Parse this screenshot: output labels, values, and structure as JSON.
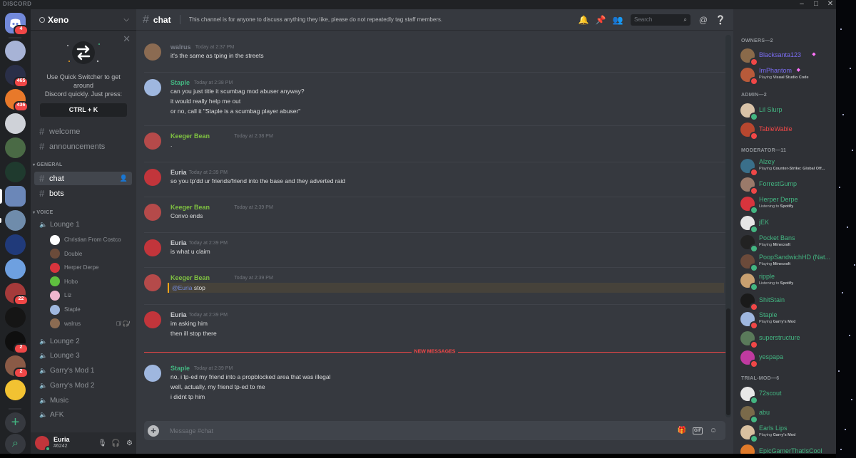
{
  "window": {
    "wordmark": "DISCORD",
    "min": "–",
    "max": "□",
    "close": "✕"
  },
  "guild_rail": {
    "home_badge": "4",
    "guilds": [
      {
        "color": "#a7b3d6",
        "badge": ""
      },
      {
        "color": "#2a2f48",
        "badge": "465"
      },
      {
        "color": "#e8792a",
        "badge": "436"
      },
      {
        "color": "#cfd2d8",
        "badge": ""
      },
      {
        "color": "#4a6a45",
        "badge": ""
      },
      {
        "color": "#1f3a2e",
        "badge": ""
      },
      {
        "color": "#6b87b8",
        "badge": ""
      },
      {
        "color": "#6f8cab",
        "badge": ""
      },
      {
        "color": "#203a7a",
        "badge": ""
      },
      {
        "color": "#6ea0e0",
        "badge": ""
      },
      {
        "color": "#a53a3a",
        "badge": "22"
      },
      {
        "color": "#151515",
        "badge": ""
      },
      {
        "color": "#0f0f0f",
        "badge": "2"
      },
      {
        "color": "#8a5a46",
        "badge": "2"
      },
      {
        "color": "#f2c232",
        "badge": ""
      }
    ],
    "add_icon": "+",
    "discover_icon": "⌕"
  },
  "server": {
    "name": "Xeno"
  },
  "quick_switcher": {
    "line1": "Use Quick Switcher to get around",
    "line2": "Discord quickly. Just press:",
    "key": "CTRL + K",
    "close": "✕"
  },
  "channels": {
    "top": [
      {
        "name": "welcome"
      },
      {
        "name": "announcements"
      }
    ],
    "general_label": "GENERAL",
    "general": [
      {
        "name": "chat"
      },
      {
        "name": "bots"
      }
    ],
    "voice_label": "VOICE",
    "voice": [
      {
        "name": "Lounge 1"
      },
      {
        "name": "Lounge 2"
      },
      {
        "name": "Lounge 3"
      },
      {
        "name": "Garry's Mod 1"
      },
      {
        "name": "Garry's Mod 2"
      },
      {
        "name": "Music"
      },
      {
        "name": "AFK"
      }
    ],
    "voice_users": [
      {
        "name": "Christian From Costco",
        "color": "#ffffff"
      },
      {
        "name": "Double",
        "color": "#6b4b3a"
      },
      {
        "name": "Herper Derpe",
        "color": "#d8343d"
      },
      {
        "name": "Hobo",
        "color": "#5fbf3f"
      },
      {
        "name": "Liz",
        "color": "#f0b6cf"
      },
      {
        "name": "Staple",
        "color": "#9fb7df"
      },
      {
        "name": "walrus",
        "color": "#8b6b52"
      }
    ]
  },
  "user_panel": {
    "name": "Euria",
    "tag": "#6242"
  },
  "chat": {
    "channel": "chat",
    "topic": "This channel is for anyone to discuss anything they like, please do not repeatedly tag staff members.",
    "search_placeholder": "Search",
    "composer_placeholder": "Message #chat",
    "new_messages": "NEW MESSAGES",
    "messages": [
      {
        "author": "walrus",
        "color": "#7a7f8a",
        "time": "Today at 2:37 PM",
        "avatar": "#8b6b52",
        "lines": [
          "it's the same as tping in the streets"
        ]
      },
      {
        "author": "Staple",
        "color": "#43b581",
        "time": "Today at 2:38 PM",
        "avatar": "#9fb7df",
        "lines": [
          "can you just title it scumbag mod abuser anyway?",
          "it would really help me out",
          "or no, call it \"Staple is a scumbag player abuser\""
        ]
      },
      {
        "author": "Keeger Bean",
        "color": "#7fc241",
        "time": "Today at 2:38 PM",
        "avatar": "#b54a4a",
        "lines": [
          "."
        ]
      },
      {
        "author": "Euria",
        "color": "#c9cbcf",
        "time": "Today at 2:39 PM",
        "avatar": "#c2353b",
        "lines": [
          "so you tp'dd ur friends/friend into the base and they adverted raid"
        ]
      },
      {
        "author": "Keeger Bean",
        "color": "#7fc241",
        "time": "Today at 2:39 PM",
        "avatar": "#b54a4a",
        "lines": [
          "Convo ends"
        ]
      },
      {
        "author": "Euria",
        "color": "#c9cbcf",
        "time": "Today at 2:39 PM",
        "avatar": "#c2353b",
        "lines": [
          "is what u claim"
        ]
      },
      {
        "author": "Keeger Bean",
        "color": "#7fc241",
        "time": "Today at 2:39 PM",
        "avatar": "#b54a4a",
        "mention": "@Euria",
        "lines": [
          " stop"
        ]
      },
      {
        "author": "Euria",
        "color": "#c9cbcf",
        "time": "Today at 2:39 PM",
        "avatar": "#c2353b",
        "lines": [
          "im asking him",
          "then ill stop there"
        ]
      },
      {
        "author": "Staple",
        "color": "#43b581",
        "time": "Today at 2:39 PM",
        "avatar": "#9fb7df",
        "lines": [
          "no, i tp-ed my friend into a propblocked area that was illegal",
          "well, actually, my friend tp-ed to me",
          "i didnt tp him"
        ]
      }
    ]
  },
  "members": {
    "categories": [
      {
        "label": "OWNERS—2"
      },
      {
        "label": "ADMIN—2"
      },
      {
        "label": "MODERATOR—11"
      },
      {
        "label": "TRIAL-MOD—6"
      }
    ],
    "list": [
      {
        "name": "Blacksanta123",
        "color": "#7a6cf0",
        "status": "#f04747",
        "avatar": "#8a6a4a",
        "boost": true
      },
      {
        "name": "ImPhantom",
        "color": "#7a6cf0",
        "status": "#f04747",
        "avatar": "#b85a3a",
        "boost": true,
        "activity_prefix": "Playing ",
        "activity": "Visual Studio Code"
      },
      {
        "name": "Lil Slurp",
        "color": "#43b581",
        "status": "#43b581",
        "avatar": "#d9c3a8"
      },
      {
        "name": "TableWable",
        "color": "#f04747",
        "status": "#f04747",
        "avatar": "#b7472f"
      },
      {
        "name": "Alzey",
        "color": "#43b581",
        "status": "#f04747",
        "avatar": "#3a6f8a",
        "activity_prefix": "Playing ",
        "activity": "Counter-Strike: Global Off..."
      },
      {
        "name": "ForrestGump",
        "color": "#43b581",
        "status": "#f04747",
        "avatar": "#9a7a6a"
      },
      {
        "name": "Herper Derpe",
        "color": "#43b581",
        "status": "#43b581",
        "avatar": "#d8343d",
        "activity_prefix": "Listening to ",
        "activity": "Spotify"
      },
      {
        "name": "jEK",
        "color": "#43b581",
        "status": "#43b581",
        "avatar": "#e6e6e6"
      },
      {
        "name": "Pocket Bans",
        "color": "#43b581",
        "status": "#43b581",
        "avatar": "#222222",
        "activity_prefix": "Playing ",
        "activity": "Minecraft"
      },
      {
        "name": "PoopSandwichHD (Nat...",
        "color": "#43b581",
        "status": "#43b581",
        "avatar": "#6b4a3a",
        "activity_prefix": "Playing ",
        "activity": "Minecraft"
      },
      {
        "name": "ripple",
        "color": "#43b581",
        "status": "#43b581",
        "avatar": "#c8a070",
        "activity_prefix": "Listening to ",
        "activity": "Spotify"
      },
      {
        "name": "ShitStain",
        "color": "#43b581",
        "status": "#f04747",
        "avatar": "#1a1a1a"
      },
      {
        "name": "Staple",
        "color": "#43b581",
        "status": "#f04747",
        "avatar": "#9fb7df",
        "activity_prefix": "Playing ",
        "activity": "Garry's Mod"
      },
      {
        "name": "superstructure",
        "color": "#43b581",
        "status": "#f04747",
        "avatar": "#5a7a5a"
      },
      {
        "name": "yespapa",
        "color": "#43b581",
        "status": "#f04747",
        "avatar": "#c03aa0"
      },
      {
        "name": "72scout",
        "color": "#43b581",
        "status": "#43b581",
        "avatar": "#e8e8e8"
      },
      {
        "name": "abu",
        "color": "#43b581",
        "status": "#43b581",
        "avatar": "#7a6a4a"
      },
      {
        "name": "Earls Lips",
        "color": "#43b581",
        "status": "#43b581",
        "avatar": "#d8c0a0",
        "activity_prefix": "Playing ",
        "activity": "Garry's Mod"
      },
      {
        "name": "EpicGamerThatIsCool",
        "color": "#43b581",
        "status": "#43b581",
        "avatar": "#e07a2a"
      }
    ]
  }
}
